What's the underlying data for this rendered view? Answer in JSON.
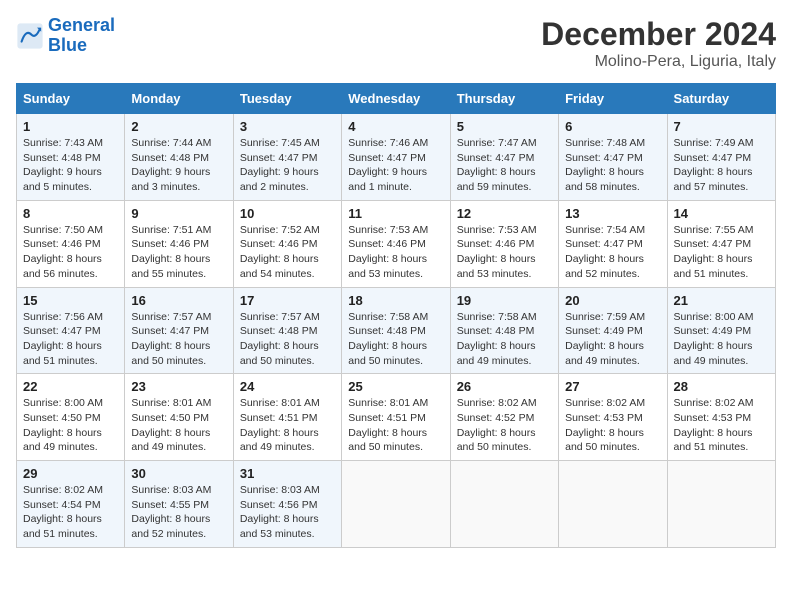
{
  "logo": {
    "line1": "General",
    "line2": "Blue"
  },
  "title": "December 2024",
  "subtitle": "Molino-Pera, Liguria, Italy",
  "days_of_week": [
    "Sunday",
    "Monday",
    "Tuesday",
    "Wednesday",
    "Thursday",
    "Friday",
    "Saturday"
  ],
  "weeks": [
    [
      {
        "day": "1",
        "sunrise": "7:43 AM",
        "sunset": "4:48 PM",
        "daylight": "9 hours and 5 minutes."
      },
      {
        "day": "2",
        "sunrise": "7:44 AM",
        "sunset": "4:48 PM",
        "daylight": "9 hours and 3 minutes."
      },
      {
        "day": "3",
        "sunrise": "7:45 AM",
        "sunset": "4:47 PM",
        "daylight": "9 hours and 2 minutes."
      },
      {
        "day": "4",
        "sunrise": "7:46 AM",
        "sunset": "4:47 PM",
        "daylight": "9 hours and 1 minute."
      },
      {
        "day": "5",
        "sunrise": "7:47 AM",
        "sunset": "4:47 PM",
        "daylight": "8 hours and 59 minutes."
      },
      {
        "day": "6",
        "sunrise": "7:48 AM",
        "sunset": "4:47 PM",
        "daylight": "8 hours and 58 minutes."
      },
      {
        "day": "7",
        "sunrise": "7:49 AM",
        "sunset": "4:47 PM",
        "daylight": "8 hours and 57 minutes."
      }
    ],
    [
      {
        "day": "8",
        "sunrise": "7:50 AM",
        "sunset": "4:46 PM",
        "daylight": "8 hours and 56 minutes."
      },
      {
        "day": "9",
        "sunrise": "7:51 AM",
        "sunset": "4:46 PM",
        "daylight": "8 hours and 55 minutes."
      },
      {
        "day": "10",
        "sunrise": "7:52 AM",
        "sunset": "4:46 PM",
        "daylight": "8 hours and 54 minutes."
      },
      {
        "day": "11",
        "sunrise": "7:53 AM",
        "sunset": "4:46 PM",
        "daylight": "8 hours and 53 minutes."
      },
      {
        "day": "12",
        "sunrise": "7:53 AM",
        "sunset": "4:46 PM",
        "daylight": "8 hours and 53 minutes."
      },
      {
        "day": "13",
        "sunrise": "7:54 AM",
        "sunset": "4:47 PM",
        "daylight": "8 hours and 52 minutes."
      },
      {
        "day": "14",
        "sunrise": "7:55 AM",
        "sunset": "4:47 PM",
        "daylight": "8 hours and 51 minutes."
      }
    ],
    [
      {
        "day": "15",
        "sunrise": "7:56 AM",
        "sunset": "4:47 PM",
        "daylight": "8 hours and 51 minutes."
      },
      {
        "day": "16",
        "sunrise": "7:57 AM",
        "sunset": "4:47 PM",
        "daylight": "8 hours and 50 minutes."
      },
      {
        "day": "17",
        "sunrise": "7:57 AM",
        "sunset": "4:48 PM",
        "daylight": "8 hours and 50 minutes."
      },
      {
        "day": "18",
        "sunrise": "7:58 AM",
        "sunset": "4:48 PM",
        "daylight": "8 hours and 50 minutes."
      },
      {
        "day": "19",
        "sunrise": "7:58 AM",
        "sunset": "4:48 PM",
        "daylight": "8 hours and 49 minutes."
      },
      {
        "day": "20",
        "sunrise": "7:59 AM",
        "sunset": "4:49 PM",
        "daylight": "8 hours and 49 minutes."
      },
      {
        "day": "21",
        "sunrise": "8:00 AM",
        "sunset": "4:49 PM",
        "daylight": "8 hours and 49 minutes."
      }
    ],
    [
      {
        "day": "22",
        "sunrise": "8:00 AM",
        "sunset": "4:50 PM",
        "daylight": "8 hours and 49 minutes."
      },
      {
        "day": "23",
        "sunrise": "8:01 AM",
        "sunset": "4:50 PM",
        "daylight": "8 hours and 49 minutes."
      },
      {
        "day": "24",
        "sunrise": "8:01 AM",
        "sunset": "4:51 PM",
        "daylight": "8 hours and 49 minutes."
      },
      {
        "day": "25",
        "sunrise": "8:01 AM",
        "sunset": "4:51 PM",
        "daylight": "8 hours and 50 minutes."
      },
      {
        "day": "26",
        "sunrise": "8:02 AM",
        "sunset": "4:52 PM",
        "daylight": "8 hours and 50 minutes."
      },
      {
        "day": "27",
        "sunrise": "8:02 AM",
        "sunset": "4:53 PM",
        "daylight": "8 hours and 50 minutes."
      },
      {
        "day": "28",
        "sunrise": "8:02 AM",
        "sunset": "4:53 PM",
        "daylight": "8 hours and 51 minutes."
      }
    ],
    [
      {
        "day": "29",
        "sunrise": "8:02 AM",
        "sunset": "4:54 PM",
        "daylight": "8 hours and 51 minutes."
      },
      {
        "day": "30",
        "sunrise": "8:03 AM",
        "sunset": "4:55 PM",
        "daylight": "8 hours and 52 minutes."
      },
      {
        "day": "31",
        "sunrise": "8:03 AM",
        "sunset": "4:56 PM",
        "daylight": "8 hours and 53 minutes."
      },
      null,
      null,
      null,
      null
    ]
  ]
}
